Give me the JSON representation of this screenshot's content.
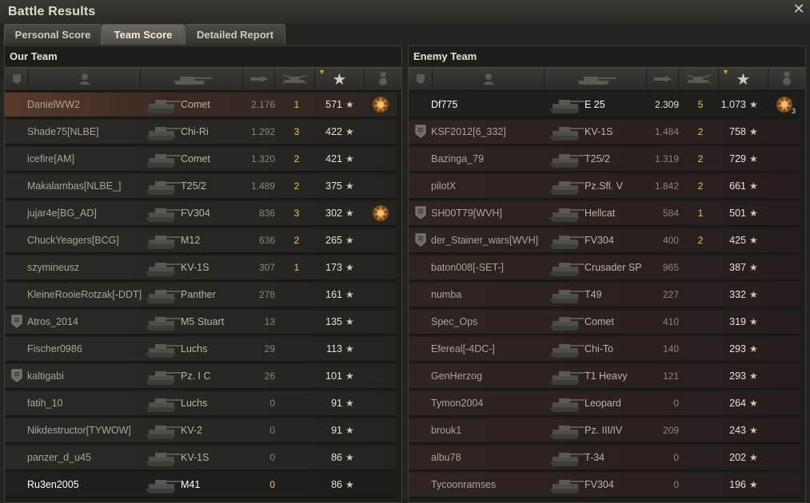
{
  "window": {
    "title": "Battle Results",
    "close_glyph": "✕"
  },
  "tabs": [
    {
      "label": "Personal Score",
      "active": false
    },
    {
      "label": "Team Score",
      "active": true
    },
    {
      "label": "Detailed Report",
      "active": false
    }
  ],
  "our_team": {
    "title": "Our Team",
    "players": [
      {
        "name": "DanielWW2",
        "tank": "Comet",
        "damage": "2.176",
        "kills": "1",
        "xp": "571",
        "badge": false,
        "medal": true,
        "highlight": true,
        "self": false
      },
      {
        "name": "Shade75[NLBE]",
        "tank": "Chi-Ri",
        "damage": "1.292",
        "kills": "3",
        "xp": "422",
        "badge": false,
        "medal": false
      },
      {
        "name": "icefire[AM]",
        "tank": "Comet",
        "damage": "1.320",
        "kills": "2",
        "xp": "421",
        "badge": false,
        "medal": false
      },
      {
        "name": "Makalambas[NLBE_]",
        "tank": "T25/2",
        "damage": "1.489",
        "kills": "2",
        "xp": "375",
        "badge": false,
        "medal": false
      },
      {
        "name": "jujar4e[BG_AD]",
        "tank": "FV304",
        "damage": "836",
        "kills": "3",
        "xp": "302",
        "badge": false,
        "medal": true
      },
      {
        "name": "ChuckYeagers[BCG]",
        "tank": "M12",
        "damage": "636",
        "kills": "2",
        "xp": "265",
        "badge": false,
        "medal": false
      },
      {
        "name": "szymineusz",
        "tank": "KV-1S",
        "damage": "307",
        "kills": "1",
        "xp": "173",
        "badge": false,
        "medal": false
      },
      {
        "name": "KleineRooieRotzak[-DDT]",
        "tank": "Panther",
        "damage": "278",
        "kills": "",
        "xp": "161",
        "badge": false,
        "medal": false
      },
      {
        "name": "Atros_2014",
        "tank": "M5 Stuart",
        "damage": "13",
        "kills": "",
        "xp": "135",
        "badge": true,
        "medal": false
      },
      {
        "name": "Fischer0986",
        "tank": "Luchs",
        "damage": "29",
        "kills": "",
        "xp": "113",
        "badge": false,
        "medal": false
      },
      {
        "name": "kaltigabi",
        "tank": "Pz. I C",
        "damage": "26",
        "kills": "",
        "xp": "101",
        "badge": true,
        "medal": false
      },
      {
        "name": "fatih_10",
        "tank": "Luchs",
        "damage": "0",
        "kills": "",
        "xp": "91",
        "badge": false,
        "medal": false
      },
      {
        "name": "Nikdestructor[TYWOW]",
        "tank": "KV-2",
        "damage": "0",
        "kills": "",
        "xp": "91",
        "badge": false,
        "medal": false
      },
      {
        "name": "panzer_d_u45",
        "tank": "KV-1S",
        "damage": "0",
        "kills": "",
        "xp": "86",
        "badge": false,
        "medal": false
      },
      {
        "name": "Ru3en2005",
        "tank": "M41",
        "damage": "0",
        "kills": "",
        "xp": "86",
        "badge": false,
        "medal": false,
        "self": true
      }
    ]
  },
  "enemy_team": {
    "title": "Enemy Team",
    "players": [
      {
        "name": "Df775",
        "tank": "E 25",
        "damage": "2.309",
        "kills": "5",
        "xp": "1.073",
        "badge": false,
        "medal": true,
        "medal_count": "3",
        "self": true
      },
      {
        "name": "KSF2012[6_332]",
        "tank": "KV-1S",
        "damage": "1.484",
        "kills": "2",
        "xp": "758",
        "badge": true,
        "medal": false
      },
      {
        "name": "Bazinga_79",
        "tank": "T25/2",
        "damage": "1.319",
        "kills": "2",
        "xp": "729",
        "badge": false,
        "medal": false
      },
      {
        "name": "pilotX",
        "tank": "Pz.Sfl. V",
        "damage": "1.842",
        "kills": "2",
        "xp": "661",
        "badge": false,
        "medal": false
      },
      {
        "name": "SH00T79[WVH]",
        "tank": "Hellcat",
        "damage": "584",
        "kills": "1",
        "xp": "501",
        "badge": true,
        "medal": false
      },
      {
        "name": "der_Stainer_wars[WVH]",
        "tank": "FV304",
        "damage": "400",
        "kills": "2",
        "xp": "425",
        "badge": true,
        "medal": false
      },
      {
        "name": "baton008[-SET-]",
        "tank": "Crusader SP",
        "damage": "965",
        "kills": "",
        "xp": "387",
        "badge": false,
        "medal": false
      },
      {
        "name": "numba",
        "tank": "T49",
        "damage": "227",
        "kills": "",
        "xp": "332",
        "badge": false,
        "medal": false
      },
      {
        "name": "Spec_Ops",
        "tank": "Comet",
        "damage": "410",
        "kills": "",
        "xp": "319",
        "badge": false,
        "medal": false
      },
      {
        "name": "Efereal[-4DC-]",
        "tank": "Chi-To",
        "damage": "140",
        "kills": "",
        "xp": "293",
        "badge": false,
        "medal": false
      },
      {
        "name": "GenHerzog",
        "tank": "T1 Heavy",
        "damage": "121",
        "kills": "",
        "xp": "293",
        "badge": false,
        "medal": false
      },
      {
        "name": "Tymon2004",
        "tank": "Leopard",
        "damage": "0",
        "kills": "",
        "xp": "264",
        "badge": false,
        "medal": false
      },
      {
        "name": "brouk1",
        "tank": "Pz. III/IV",
        "damage": "209",
        "kills": "",
        "xp": "243",
        "badge": false,
        "medal": false
      },
      {
        "name": "albu78",
        "tank": "T-34",
        "damage": "0",
        "kills": "",
        "xp": "202",
        "badge": false,
        "medal": false
      },
      {
        "name": "Tycoonramses",
        "tank": "FV304",
        "damage": "0",
        "kills": "",
        "xp": "196",
        "badge": false,
        "medal": false
      }
    ]
  },
  "columns": [
    "rank-badge-icon",
    "player-icon",
    "tank-icon",
    "damage-icon",
    "kills-icon",
    "xp-star-icon",
    "medal-icon"
  ],
  "star_glyph": "★"
}
